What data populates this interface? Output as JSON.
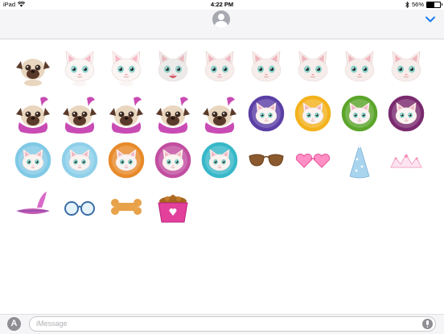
{
  "status": {
    "device": "iPad",
    "wifi_icon": "wifi-icon",
    "time": "4:22 PM",
    "bluetooth_icon": "bluetooth-icon",
    "battery_percent": "56%",
    "battery_level": 0.56
  },
  "header": {
    "avatar_icon": "contact-avatar-icon",
    "collapse_icon": "chevron-down-icon",
    "accent_color": "#1a7cf0"
  },
  "stickers": [
    {
      "kind": "pug",
      "label": "pug-sitting"
    },
    {
      "kind": "cat-white",
      "label": "white-cat-happy"
    },
    {
      "kind": "cat-white",
      "label": "white-cat-hearts"
    },
    {
      "kind": "cat-grey",
      "label": "grey-cat-laughing"
    },
    {
      "kind": "cat-face",
      "label": "cat-face-1"
    },
    {
      "kind": "cat-face",
      "label": "cat-face-2"
    },
    {
      "kind": "cat-face",
      "label": "cat-face-3"
    },
    {
      "kind": "cat-face",
      "label": "cat-face-4"
    },
    {
      "kind": "cat-face",
      "label": "cat-face-5"
    },
    {
      "kind": "pug-boa",
      "label": "pug-boa-1"
    },
    {
      "kind": "pug-boa",
      "label": "pug-boa-2"
    },
    {
      "kind": "pug-boa",
      "label": "pug-boa-wink"
    },
    {
      "kind": "pug-boa",
      "label": "pug-boa-3"
    },
    {
      "kind": "pug-boa",
      "label": "pug-boa-4"
    },
    {
      "kind": "circle",
      "label": "cat-astronaut",
      "bg": "#5b3fa6"
    },
    {
      "kind": "circle",
      "label": "cat-hairdryer",
      "bg": "#f3b21c"
    },
    {
      "kind": "circle",
      "label": "pug-green",
      "bg": "#5aa52a"
    },
    {
      "kind": "circle",
      "label": "cat-pink-stage",
      "bg": "#7a2a6e"
    },
    {
      "kind": "circle",
      "label": "cat-curlers",
      "bg": "#7fc9e6"
    },
    {
      "kind": "circle",
      "label": "cat-tiara",
      "bg": "#8ed0ea"
    },
    {
      "kind": "circle",
      "label": "cat-and-pug-hats",
      "bg": "#e88a2a"
    },
    {
      "kind": "circle",
      "label": "cat-bow",
      "bg": "#c24ea0"
    },
    {
      "kind": "circle",
      "label": "cat-blue-outfit",
      "bg": "#37b8c8"
    },
    {
      "kind": "sunglasses",
      "label": "sunglasses"
    },
    {
      "kind": "heart-glasses",
      "label": "heart-glasses"
    },
    {
      "kind": "party-hat",
      "label": "party-hat"
    },
    {
      "kind": "tiara",
      "label": "tiara"
    },
    {
      "kind": "feather",
      "label": "feather-boa"
    },
    {
      "kind": "glasses",
      "label": "glasses"
    },
    {
      "kind": "bone",
      "label": "bone"
    },
    {
      "kind": "bowl",
      "label": "food-bowl"
    }
  ],
  "composer": {
    "apps_icon": "app-store-icon",
    "apps_glyph": "A",
    "placeholder": "iMessage",
    "mic_icon": "microphone-icon"
  }
}
